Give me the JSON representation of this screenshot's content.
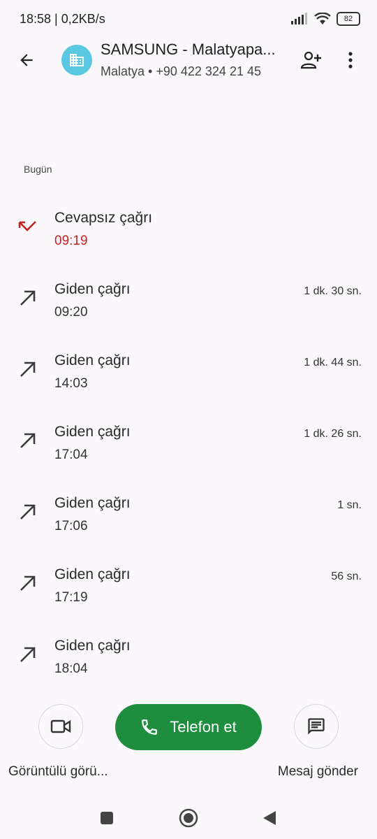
{
  "status": {
    "time": "18:58",
    "speed": "0,2KB/s",
    "battery": "82"
  },
  "contact": {
    "name": "SAMSUNG - Malatyapa...",
    "location": "Malatya",
    "phone": "+90 422 324 21 45"
  },
  "section_label": "Bugün",
  "calls": [
    {
      "type": "Cevapsız çağrı",
      "time": "09:19",
      "duration": "",
      "kind": "missed"
    },
    {
      "type": "Giden çağrı",
      "time": "09:20",
      "duration": "1 dk. 30 sn.",
      "kind": "outgoing"
    },
    {
      "type": "Giden çağrı",
      "time": "14:03",
      "duration": "1 dk. 44 sn.",
      "kind": "outgoing"
    },
    {
      "type": "Giden çağrı",
      "time": "17:04",
      "duration": "1 dk. 26 sn.",
      "kind": "outgoing"
    },
    {
      "type": "Giden çağrı",
      "time": "17:06",
      "duration": "1 sn.",
      "kind": "outgoing"
    },
    {
      "type": "Giden çağrı",
      "time": "17:19",
      "duration": "56 sn.",
      "kind": "outgoing"
    },
    {
      "type": "Giden çağrı",
      "time": "18:04",
      "duration": "",
      "kind": "outgoing"
    }
  ],
  "actions": {
    "call_label": "Telefon et",
    "video_label": "Görüntülü görü...",
    "message_label": "Mesaj gönder"
  },
  "colors": {
    "call_button": "#1e8e3e",
    "missed": "#c5221f",
    "avatar": "#5ac8e0"
  }
}
